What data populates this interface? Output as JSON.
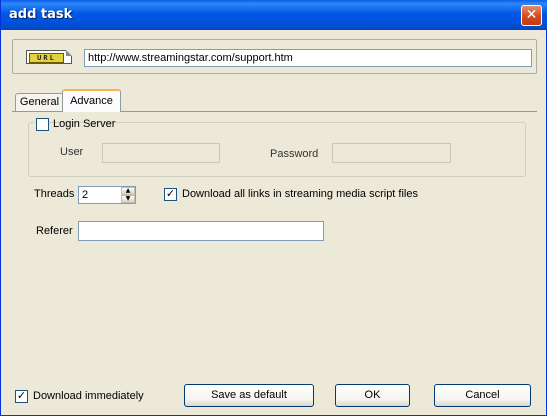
{
  "window": {
    "title": "add task"
  },
  "url": {
    "icon_text": "URL",
    "value": "http://www.streamingstar.com/support.htm"
  },
  "tabs": [
    {
      "label": "General",
      "active": false
    },
    {
      "label": "Advance",
      "active": true
    }
  ],
  "login": {
    "checkbox_label": "Login Server",
    "checked": false,
    "user_label": "User",
    "user_value": "",
    "password_label": "Password",
    "password_value": ""
  },
  "threads": {
    "label": "Threads",
    "value": "2"
  },
  "download_links": {
    "label": "Download all links in streaming media script files",
    "checked": true
  },
  "referer": {
    "label": "Referer",
    "value": ""
  },
  "footer": {
    "download_immediately_label": "Download immediately",
    "download_immediately_checked": true,
    "save_default_label": "Save as default",
    "ok_label": "OK",
    "cancel_label": "Cancel"
  },
  "icons": {
    "close": "close-icon",
    "url": "url-icon",
    "spin_up": "spin-up-icon",
    "spin_down": "spin-down-icon",
    "check": "checkmark-icon"
  },
  "colors": {
    "titlebar": "#0058e6",
    "dialog": "#ece9d8",
    "close": "#d24b20",
    "tab_highlight": "#f7b64b"
  }
}
